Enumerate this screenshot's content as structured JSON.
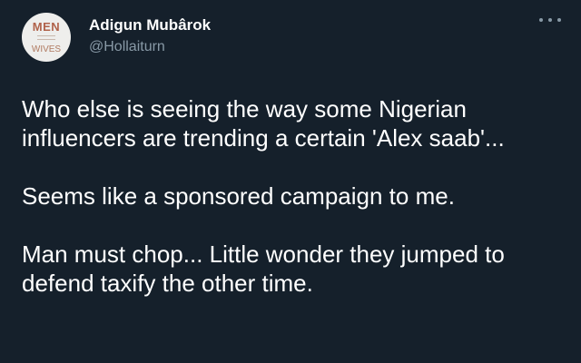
{
  "tweet": {
    "author": {
      "display_name": "Adigun Mubârok",
      "handle": "@Hollaiturn",
      "avatar_text_top": "MEN",
      "avatar_text_bottom": "WIVES"
    },
    "more_icon": "more-horizontal-icon",
    "paragraphs": [
      "Who else is seeing the way some Nigerian influencers are trending a certain 'Alex saab'...",
      "Seems like a sponsored campaign to me.",
      "Man must chop... Little wonder they jumped to defend taxify the other time."
    ]
  },
  "colors": {
    "background": "#15202b",
    "text": "#ffffff",
    "secondary_text": "#8899a6"
  }
}
